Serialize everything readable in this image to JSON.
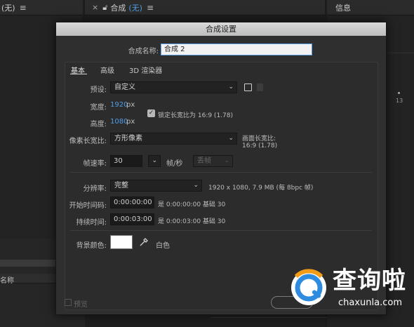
{
  "bg": {
    "left_tab_text": "(无)",
    "center_tab_close": "×",
    "center_tab_title": "合成",
    "center_tab_suffix": "(无)",
    "info_tab_title": "信息",
    "bottom_left_label": "名称",
    "right_number": "13"
  },
  "dialog": {
    "title": "合成设置",
    "name_label": "合成名称:",
    "name_value": "合成 2",
    "tabs": [
      "基本",
      "高级",
      "3D 渲染器"
    ],
    "preset_label": "预设:",
    "preset_value": "自定义",
    "width_label": "宽度:",
    "width_value": "1920",
    "width_unit": "px",
    "height_label": "高度:",
    "height_value": "1080",
    "height_unit": "px",
    "lock_label": "锁定长宽比为 16:9 (1.78)",
    "par_label": "像素长宽比:",
    "par_value": "方形像素",
    "frame_aspect_label": "画面长宽比:",
    "frame_aspect_value": "16:9 (1.78)",
    "fps_label": "帧速率:",
    "fps_value": "30",
    "fps_unit": "帧/秒",
    "drop_frame": "丢帧",
    "res_label": "分辨率:",
    "res_value": "完整",
    "res_info": "1920 x 1080,  7.9 MB (每 8bpc 帧)",
    "start_label": "开始时间码:",
    "start_value": "0:00:00:00",
    "start_info": "是 0:00:00:00  基础 30",
    "dur_label": "持续时间:",
    "dur_value": "0:00:03:00",
    "dur_info": "是 0:00:03:00  基础 30",
    "bg_label": "背景颜色:",
    "bg_color_name": "白色",
    "bg_color": "#ffffff",
    "preview_label": "预览"
  },
  "watermark": {
    "title": "查询啦",
    "url": "chaxunla.com"
  }
}
